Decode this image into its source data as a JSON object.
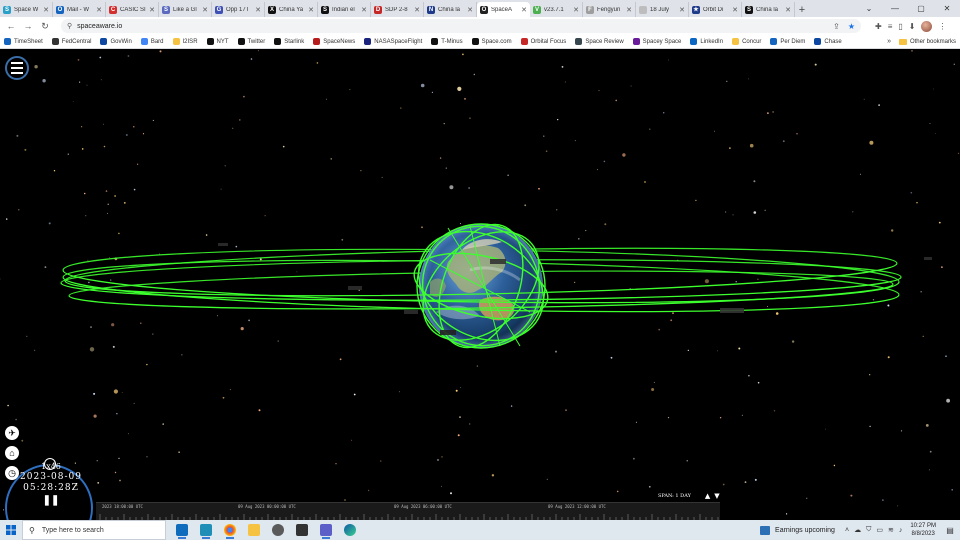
{
  "browser": {
    "tabs": [
      {
        "title": "Space W",
        "color": "#2aa0c8",
        "glyph": "S"
      },
      {
        "title": "Mail - W",
        "color": "#1565c0",
        "glyph": "O"
      },
      {
        "title": "CASIC SI",
        "color": "#d32f2f",
        "glyph": "C"
      },
      {
        "title": "Like a Gl",
        "color": "#5c6bc0",
        "glyph": "S"
      },
      {
        "title": "Opp 17T",
        "color": "#3f51b5",
        "glyph": "G"
      },
      {
        "title": "China Ya",
        "color": "#111111",
        "glyph": "X"
      },
      {
        "title": "Indian el",
        "color": "#111111",
        "glyph": "S"
      },
      {
        "title": "SDP 2-8",
        "color": "#c62828",
        "glyph": "D"
      },
      {
        "title": "China la",
        "color": "#1e3a8a",
        "glyph": "N"
      },
      {
        "title": "SpaceA",
        "color": "#222222",
        "glyph": "O",
        "active": true
      },
      {
        "title": "v23.7.1",
        "color": "#4caf50",
        "glyph": "V"
      },
      {
        "title": "Fengyun",
        "color": "#9e9e9e",
        "glyph": "F"
      },
      {
        "title": "18 July",
        "color": "#bdbdbd",
        "glyph": ""
      },
      {
        "title": "Orbit Di",
        "color": "#1e3a8a",
        "glyph": "★"
      },
      {
        "title": "China la",
        "color": "#111111",
        "glyph": "S"
      }
    ],
    "new_tab": "+",
    "window_controls": {
      "chevron": "⌄",
      "minimize": "—",
      "maximize": "▢",
      "close": "✕"
    },
    "url": "spaceaware.io",
    "nav": {
      "back": "←",
      "forward": "→",
      "reload": "↻"
    }
  },
  "bookmarks": [
    {
      "label": "TimeSheet",
      "color": "#1565c0"
    },
    {
      "label": "FedCentral",
      "color": "#333333"
    },
    {
      "label": "GovWin",
      "color": "#0d47a1"
    },
    {
      "label": "Bard",
      "color": "#4285f4"
    },
    {
      "label": "I2ISR",
      "color": "#f5c242"
    },
    {
      "label": "NYT",
      "color": "#111111"
    },
    {
      "label": "Twitter",
      "color": "#111111"
    },
    {
      "label": "Starlink",
      "color": "#111111"
    },
    {
      "label": "SpaceNews",
      "color": "#b71c1c"
    },
    {
      "label": "NASASpaceFlight",
      "color": "#1a237e"
    },
    {
      "label": "T-Minus",
      "color": "#111111"
    },
    {
      "label": "Space.com",
      "color": "#111111"
    },
    {
      "label": "Orbital Focus",
      "color": "#c62828"
    },
    {
      "label": "Space Review",
      "color": "#37474f"
    },
    {
      "label": "Spacey Space",
      "color": "#6a1b9a"
    },
    {
      "label": "LinkedIn",
      "color": "#0a66c2"
    },
    {
      "label": "Concur",
      "color": "#f5c242"
    },
    {
      "label": "Per Diem",
      "color": "#1565c0"
    },
    {
      "label": "Chase",
      "color": "#0d47a1"
    }
  ],
  "bookmarks_more": "»",
  "bookmarks_other": "Other bookmarks",
  "app": {
    "sim_speed": "1x46",
    "date": "2023-08-09",
    "time": "05:28:28Z",
    "pause_glyph": "❚❚",
    "timespan_label": "SPAN: 1 DAY",
    "timeline_labels": [
      "2023 18:00:00 UTC",
      "09 Aug 2023 00:00:00 UTC",
      "09 Aug 2023 06:00:00 UTC",
      "09 Aug 2023 12:00:00 UTC"
    ],
    "span_up": "▲",
    "span_down": "▼",
    "orbit_color": "#3dff2e"
  },
  "taskbar": {
    "search_placeholder": "Type here to search",
    "weather_text": "Earnings upcoming",
    "time": "10:27 PM",
    "date": "8/8/2023"
  }
}
